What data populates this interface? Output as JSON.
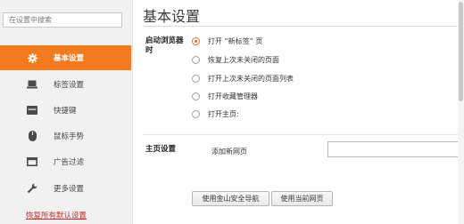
{
  "sidebar": {
    "search_placeholder": "在设置中搜索",
    "items": [
      {
        "label": "基本设置",
        "icon": "gear-icon",
        "active": true
      },
      {
        "label": "标签设置",
        "icon": "laptop-icon",
        "active": false
      },
      {
        "label": "快捷键",
        "icon": "keyboard-icon",
        "active": false
      },
      {
        "label": "鼠标手势",
        "icon": "mouse-icon",
        "active": false
      },
      {
        "label": "广告过滤",
        "icon": "window-icon",
        "active": false
      },
      {
        "label": "更多设置",
        "icon": "wrench-icon",
        "active": false
      }
    ],
    "restore_label": "恢复所有默认设置"
  },
  "main": {
    "title": "基本设置",
    "startup": {
      "label": "启动浏览器时",
      "options": [
        "打开 “新标签” 页",
        "恢复上次未关闭的页面",
        "打开上次未关闭的页面列表",
        "打开收藏管理器",
        "打开主页:"
      ],
      "selected_index": 0
    },
    "homepage": {
      "label": "主页设置",
      "field_label": "添加新网页",
      "input_value": "",
      "buttons": [
        "使用金山安全导航",
        "使用当前网页"
      ]
    }
  },
  "colors": {
    "accent": "#f47a1f",
    "restore_link": "#c03030"
  }
}
